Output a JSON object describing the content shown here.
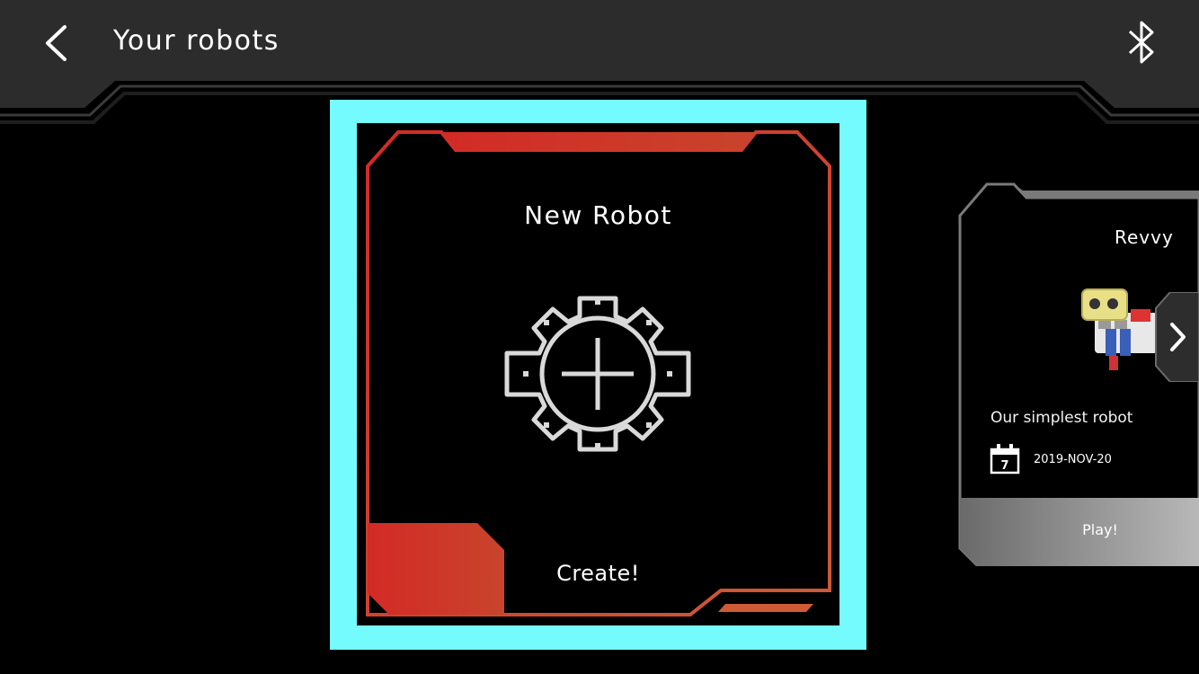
{
  "header": {
    "title": "Your robots",
    "back_icon": "chevron-left-icon",
    "bluetooth_icon": "bluetooth-icon"
  },
  "new_robot_card": {
    "title": "New Robot",
    "action_label": "Create!",
    "icon": "gear-plus-icon",
    "selected": true
  },
  "robot_card": {
    "name": "Revvy",
    "description": "Our simplest robot",
    "date": "2019-NOV-20",
    "calendar_day": "7",
    "play_label": "Play!",
    "calendar_icon": "calendar-icon",
    "next_icon": "chevron-right-icon"
  },
  "colors": {
    "background": "#000000",
    "header": "#2b2b2b",
    "selection_frame": "#74fbfd",
    "card_border": "#d43527",
    "gear": "#d9d9d9",
    "robot_card_border": "#8a8a8a",
    "play_button": "#a0a0a0"
  }
}
